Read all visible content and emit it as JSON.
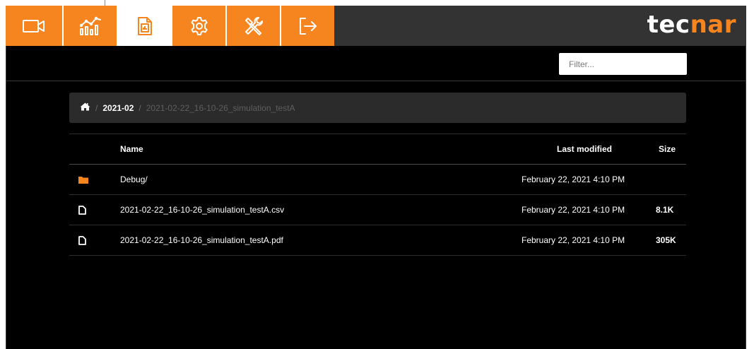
{
  "toolbar": {
    "tabs": [
      {
        "name": "camera",
        "icon": "video-camera-icon"
      },
      {
        "name": "charts",
        "icon": "chart-icon"
      },
      {
        "name": "reports",
        "icon": "report-file-icon",
        "active": true
      },
      {
        "name": "settings",
        "icon": "gear-icon"
      },
      {
        "name": "tools",
        "icon": "tools-icon"
      },
      {
        "name": "logout",
        "icon": "logout-icon"
      }
    ],
    "logo": {
      "part1": "tec",
      "part2": "nar"
    },
    "colors": {
      "accent": "#f7851f",
      "toolbar_bg": "#333333",
      "page_bg": "#000000"
    }
  },
  "filter": {
    "placeholder": "Filter..."
  },
  "breadcrumb": {
    "home_icon": "home-icon",
    "separator": "/",
    "items": [
      "2021-02",
      "2021-02-22_16-10-26_simulation_testA"
    ]
  },
  "table": {
    "headers": {
      "name": "Name",
      "modified": "Last modified",
      "size": "Size"
    },
    "rows": [
      {
        "icon": "folder-icon",
        "name": "Debug/",
        "modified": "February 22, 2021 4:10 PM",
        "size": ""
      },
      {
        "icon": "file-icon",
        "name": "2021-02-22_16-10-26_simulation_testA.csv",
        "modified": "February 22, 2021 4:10 PM",
        "size": "8.1K"
      },
      {
        "icon": "file-icon",
        "name": "2021-02-22_16-10-26_simulation_testA.pdf",
        "modified": "February 22, 2021 4:10 PM",
        "size": "305K"
      }
    ]
  }
}
